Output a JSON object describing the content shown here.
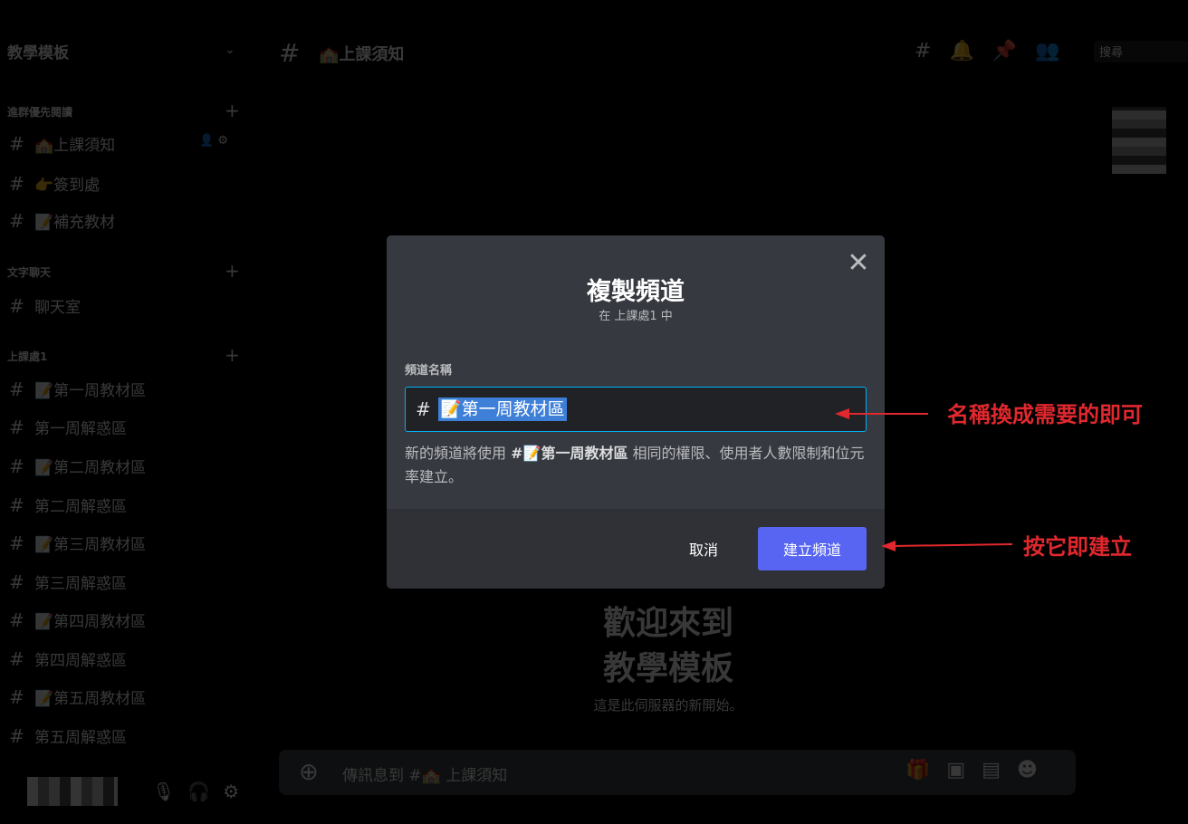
{
  "sidebar": {
    "server_name": "教學模板",
    "categories": [
      {
        "label": "進群優先閱讀"
      },
      {
        "label": "文字聊天"
      },
      {
        "label": "上課處1"
      }
    ],
    "channels_cat1": [
      {
        "icon": "🏫",
        "name": "上課須知"
      },
      {
        "icon": "👉",
        "name": "簽到處"
      },
      {
        "icon": "📝",
        "name": "補充教材"
      }
    ],
    "channels_cat2": [
      {
        "icon": "",
        "name": "聊天室"
      }
    ],
    "channels_cat3": [
      {
        "icon": "📝",
        "name": "第一周教材區"
      },
      {
        "icon": "",
        "name": "第一周解惑區"
      },
      {
        "icon": "📝",
        "name": "第二周教材區"
      },
      {
        "icon": "",
        "name": "第二周解惑區"
      },
      {
        "icon": "📝",
        "name": "第三周教材區"
      },
      {
        "icon": "",
        "name": "第三周解惑區"
      },
      {
        "icon": "📝",
        "name": "第四周教材區"
      },
      {
        "icon": "",
        "name": "第四周解惑區"
      },
      {
        "icon": "📝",
        "name": "第五周教材區"
      },
      {
        "icon": "",
        "name": "第五周解惑區"
      }
    ]
  },
  "header": {
    "channel_icon": "🏫",
    "channel_name": "上課須知",
    "search_placeholder": "搜尋"
  },
  "welcome": {
    "line1": "歡迎來到",
    "line2": "教學模板",
    "subtitle": "這是此伺服器的新開始。"
  },
  "message_bar": {
    "placeholder": "傳訊息到 #🏫 上課須知"
  },
  "modal": {
    "title": "複製頻道",
    "subtitle": "在 上課處1 中",
    "field_label": "頻道名稱",
    "prefix": "#",
    "field_value": "📝第一周教材區",
    "desc_before": "新的頻道將使用",
    "desc_channel": "#📝第一周教材區",
    "desc_after": "相同的權限、使用者人數限制和位元率建立。",
    "cancel_label": "取消",
    "create_label": "建立頻道"
  },
  "annotations": {
    "name_hint": "名稱換成需要的即可",
    "create_hint": "按它即建立"
  },
  "colors": {
    "accent": "#5865f2",
    "annotation": "#e0282e",
    "modal_bg": "#36393f",
    "selection": "#3e7fd8"
  }
}
